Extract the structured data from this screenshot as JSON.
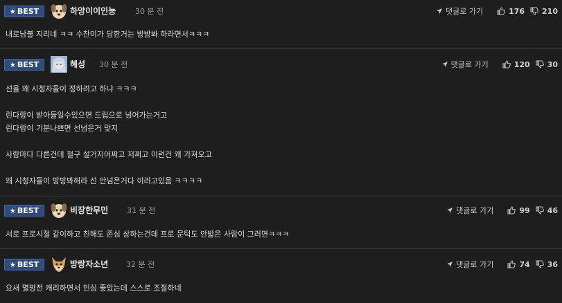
{
  "badge": {
    "star": "★",
    "label": "BEST"
  },
  "reply_label": "댓글로 가기",
  "icons": {
    "reply": "arrow-icon",
    "like": "thumbs-up-icon",
    "dislike": "thumbs-down-icon"
  },
  "comments": [
    {
      "nickname": "하앙이이인눙",
      "time": "30 분 전",
      "likes": "176",
      "dislikes": "210",
      "avatar": "dog-avatar",
      "lines": [
        "내로남불 지리네 ㅋㅋ 수찬이가 당한거는 방방봐 하라면서ㅋㅋㅋ"
      ]
    },
    {
      "nickname": "혜성",
      "time": "30 분 전",
      "likes": "120",
      "dislikes": "30",
      "avatar": "anime-girl-avatar",
      "lines": [
        "선을 왜 시청자들이 정하려고 하냐 ㅋㅋㅋ",
        "린다랑이 받아들일수있으면 드립으로 넘어가는거고",
        "린다랑이 기분나쁘면 선넘은거 맞지",
        "사람마다 다른건데 철구 설거지어쩌고 저쩌고 이런건 왜 가져오고",
        "왜 시청자들이 방방봐해라 선 안넘은거다 이러고있음 ㅋㅋㅋㅋ"
      ]
    },
    {
      "nickname": "비장한무민",
      "time": "31 분 전",
      "likes": "99",
      "dislikes": "46",
      "avatar": "dog-avatar",
      "lines": [
        "서로 프로시절 같이하고 친해도 존심 상하는건데 프로 문턱도 안밟은 사람이 그러면ㅋㅋㅋ"
      ]
    },
    {
      "nickname": "방랑자소년",
      "time": "32 분 전",
      "likes": "74",
      "dislikes": "36",
      "avatar": "fox-avatar",
      "lines": [
        "요새 멸망전 캐리하면서 민심 좋았는데 스스로 조절하네"
      ]
    }
  ]
}
